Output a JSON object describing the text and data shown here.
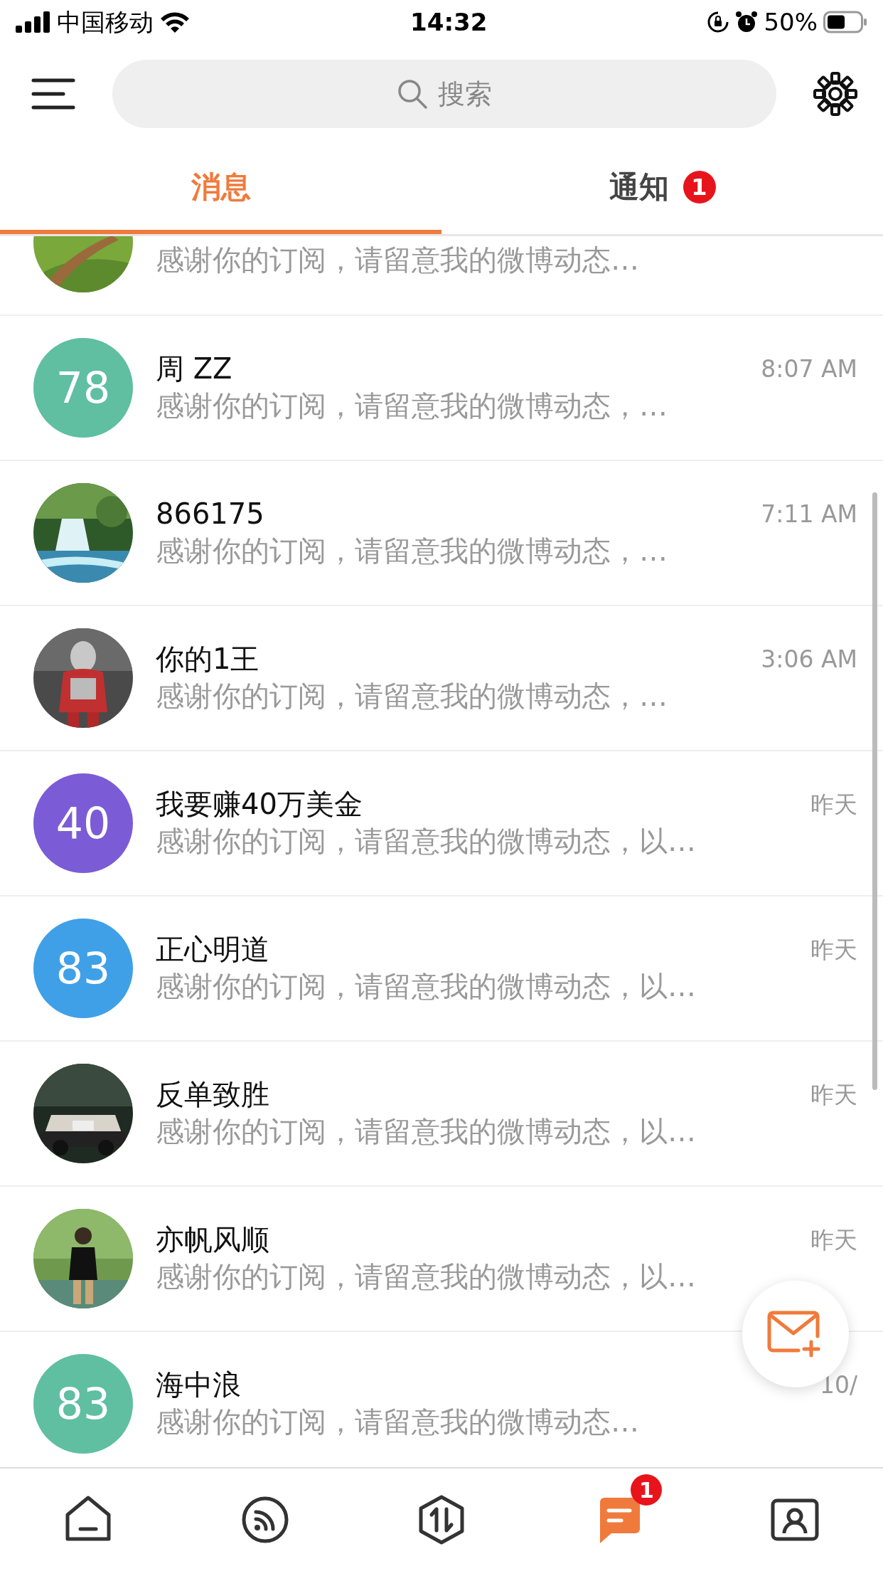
{
  "status_bar": {
    "carrier": "中国移动",
    "time": "14:32",
    "battery": "50%"
  },
  "search": {
    "placeholder": "搜索"
  },
  "tabs": [
    {
      "label": "消息",
      "selected": true
    },
    {
      "label": "通知",
      "selected": false,
      "badge": "1"
    }
  ],
  "conversations": [
    {
      "preview": "感谢你的订阅，请留意我的微博动态…"
    },
    {
      "avatar": {
        "kind": "number",
        "text": "78",
        "color": "#5fbfa0"
      },
      "name": "周 ZZ",
      "time": "8:07 AM",
      "preview": "感谢你的订阅，请留意我的微博动态，…"
    },
    {
      "name": "866175",
      "time": "7:11 AM",
      "preview": "感谢你的订阅，请留意我的微博动态，…"
    },
    {
      "name": "你的1王",
      "time": "3:06 AM",
      "preview": "感谢你的订阅，请留意我的微博动态，…"
    },
    {
      "avatar": {
        "kind": "number",
        "text": "40",
        "color": "#7b5cd6"
      },
      "name": "我要赚40万美金",
      "time": "昨天",
      "preview": "感谢你的订阅，请留意我的微博动态，以…"
    },
    {
      "avatar": {
        "kind": "number",
        "text": "83",
        "color": "#3fa0e8"
      },
      "name": "正心明道",
      "time": "昨天",
      "preview": "感谢你的订阅，请留意我的微博动态，以…"
    },
    {
      "name": "反单致胜",
      "time": "昨天",
      "preview": "感谢你的订阅，请留意我的微博动态，以…"
    },
    {
      "name": "亦帆风顺",
      "time": "昨天",
      "preview": "感谢你的订阅，请留意我的微博动态，以…"
    },
    {
      "avatar": {
        "kind": "number",
        "text": "83",
        "color": "#5fbfa0"
      },
      "name": "海中浪",
      "time": "10/",
      "preview": "感谢你的订阅，请留意我的微博动态…"
    }
  ],
  "bottom_nav": [
    {
      "kind": "home",
      "selected": false
    },
    {
      "kind": "feed",
      "selected": false
    },
    {
      "kind": "trade",
      "selected": false
    },
    {
      "kind": "messages",
      "selected": true,
      "badge": "1"
    },
    {
      "kind": "contacts",
      "selected": false
    }
  ]
}
